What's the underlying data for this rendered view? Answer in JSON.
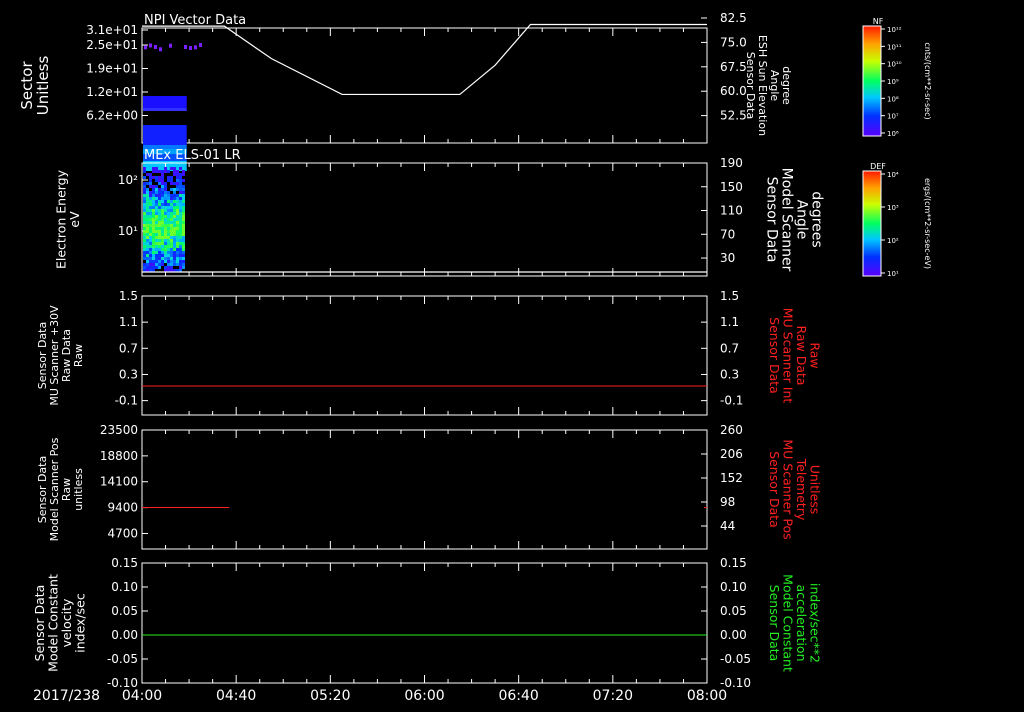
{
  "date_label": "2017/238",
  "time_axis": {
    "start": "04:00",
    "end": "08:00",
    "ticks": [
      "04:00",
      "04:40",
      "05:20",
      "06:00",
      "06:40",
      "07:20",
      "08:00"
    ]
  },
  "panels": [
    {
      "id": "npi",
      "title": "NPI Vector Data",
      "left_label": [
        "Sector",
        "Unitless"
      ],
      "left_ticks": [
        "3.1e+01",
        "2.5e+01",
        "1.9e+01",
        "1.2e+01",
        "6.2e+00"
      ],
      "right_label": [
        "Sensor Data",
        "ESH Sun Elevation",
        "Angle",
        "degree"
      ],
      "right_ticks": [
        "82.5",
        "75.0",
        "67.5",
        "60.0",
        "52.5"
      ],
      "right_color": "#ffffff"
    },
    {
      "id": "els",
      "title": "MEx ELS-01 LR",
      "left_label": [
        "Electron Energy",
        "eV"
      ],
      "left_ticks": [
        "10²",
        "10¹"
      ],
      "right_label": [
        "Sensor Data",
        "Model Scanner",
        "Angle",
        "degrees"
      ],
      "right_ticks": [
        "190",
        "150",
        "110",
        "70",
        "30"
      ],
      "right_color": "#ffffff"
    },
    {
      "id": "mu_int",
      "title": "",
      "left_label": [
        "Sensor Data",
        "MU Scanner +30V",
        "Raw Data",
        "Raw"
      ],
      "left_ticks": [
        "1.5",
        "1.1",
        "0.7",
        "0.3",
        "-0.1"
      ],
      "right_label": [
        "Sensor Data",
        "MU Scanner Int",
        "Raw Data",
        "Raw"
      ],
      "right_ticks": [
        "1.5",
        "1.1",
        "0.7",
        "0.3",
        "-0.1"
      ],
      "right_color": "#ff2020"
    },
    {
      "id": "mu_pos",
      "title": "",
      "left_label": [
        "Sensor Data",
        "Model Scanner Pos",
        "Raw",
        "unitless"
      ],
      "left_ticks": [
        "23500",
        "18800",
        "14100",
        "9400",
        "4700"
      ],
      "right_label": [
        "Sensor Data",
        "MU Scanner Pos",
        "Telemetry",
        "Unitless"
      ],
      "right_ticks": [
        "260",
        "206",
        "152",
        "98",
        "44"
      ],
      "right_color": "#ff2020"
    },
    {
      "id": "const",
      "title": "",
      "left_label": [
        "Sensor Data",
        "Model Constant",
        "velocity",
        "index/sec"
      ],
      "left_ticks": [
        "0.15",
        "0.10",
        "0.05",
        "0.00",
        "-0.05",
        "-0.10"
      ],
      "right_label": [
        "Sensor Data",
        "Model Constant",
        "acceleration",
        "index/sec**2"
      ],
      "right_ticks": [
        "0.15",
        "0.10",
        "0.05",
        "0.00",
        "-0.05",
        "-0.10"
      ],
      "right_color": "#22ee22"
    }
  ],
  "colorbars": [
    {
      "id": "nf",
      "title": "NF",
      "ticks": [
        "10¹²",
        "10¹¹",
        "10¹⁰",
        "10⁹",
        "10⁸",
        "10⁷",
        "10⁶"
      ],
      "unit": "cnts/(cm**2-sr-sec)"
    },
    {
      "id": "def",
      "title": "DEF",
      "ticks": [
        "10⁴",
        "10³",
        "10²",
        "10¹"
      ],
      "unit": "ergs/(cm**2-sr-sec-eV)"
    }
  ],
  "chart_data": [
    {
      "type": "line",
      "title": "NPI Vector Data",
      "series": [
        {
          "name": "ESH Sun Elevation Angle",
          "axis": "right",
          "color": "#ffffff",
          "x": [
            "04:00",
            "04:35",
            "04:55",
            "05:25",
            "06:15",
            "06:30",
            "06:45",
            "08:00"
          ],
          "y": [
            80.0,
            80.0,
            70.0,
            59.0,
            59.0,
            68.0,
            80.5,
            80.5
          ]
        }
      ],
      "spectrogram": {
        "quantity": "NF",
        "x_range": [
          "04:00",
          "04:19"
        ],
        "sectors_filled": [
          0,
          16
        ],
        "scattered_points_near": 25
      },
      "ylim_left": [
        0,
        31
      ],
      "ylim_right": [
        45,
        82.5
      ]
    },
    {
      "type": "heatmap",
      "title": "MEx ELS-01 LR",
      "ylabel": "Electron Energy eV",
      "x_range": [
        "04:00",
        "04:19"
      ],
      "y_scale": "log",
      "y_range": [
        1,
        200
      ],
      "quantity": "DEF",
      "series": [
        {
          "name": "Model Scanner Angle",
          "axis": "right",
          "color": "#ffffff",
          "x": [
            "04:00",
            "08:00"
          ],
          "y": [
            15,
            15
          ]
        }
      ],
      "ylim_right": [
        10,
        190
      ]
    },
    {
      "type": "line",
      "series": [
        {
          "name": "MU Scanner Int Raw Data",
          "axis": "right",
          "color": "#ff2020",
          "x": [
            "04:00",
            "08:00"
          ],
          "y": [
            0.0,
            0.0
          ]
        }
      ],
      "ylim": [
        -0.3,
        1.5
      ]
    },
    {
      "type": "line",
      "series": [
        {
          "name": "Model Scanner Pos Raw",
          "axis": "left",
          "color": "#ff2020",
          "x": [
            "04:00",
            "04:37"
          ],
          "y": [
            8000,
            8000
          ]
        }
      ],
      "ylim_left": [
        0,
        23500
      ],
      "ylim_right": [
        0,
        260
      ]
    },
    {
      "type": "line",
      "series": [
        {
          "name": "Model Constant velocity",
          "axis": "left",
          "color": "#22ee22",
          "x": [
            "04:00",
            "08:00"
          ],
          "y": [
            0.0,
            0.0
          ]
        }
      ],
      "ylim": [
        -0.1,
        0.15
      ]
    }
  ]
}
